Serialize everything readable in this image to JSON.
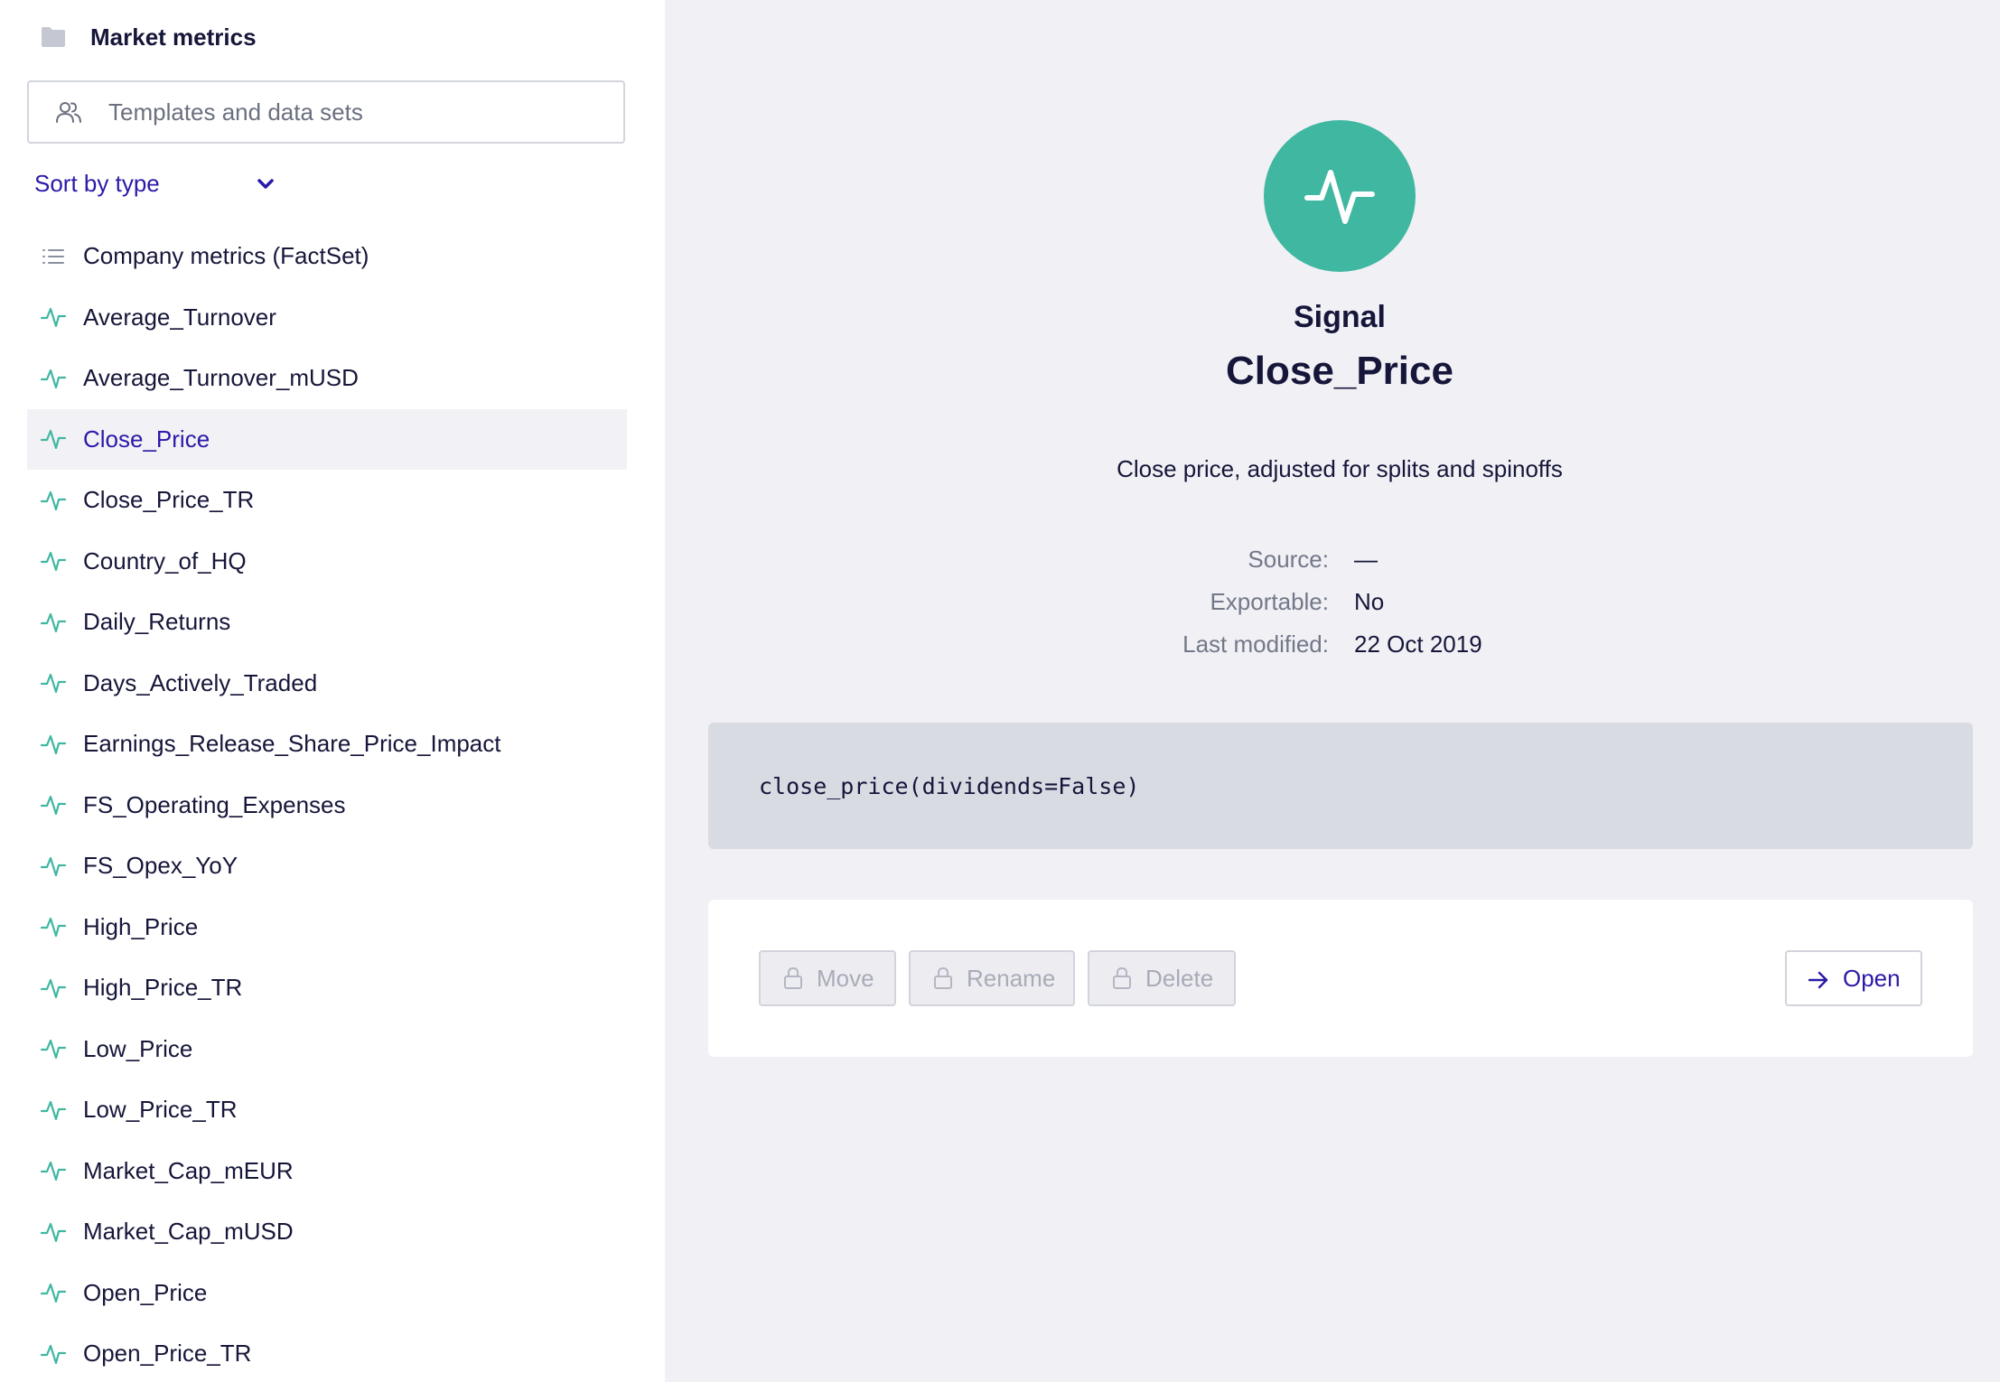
{
  "sidebar": {
    "title": "Market metrics",
    "folder_icon": "folder-icon",
    "search": {
      "placeholder": "Templates and data sets",
      "icon": "users-icon"
    },
    "sort": {
      "label": "Sort by type",
      "icon": "chevron-down-icon"
    },
    "items": [
      {
        "label": "Company metrics (FactSet)",
        "icon": "list-icon",
        "selected": false
      },
      {
        "label": "Average_Turnover",
        "icon": "signal-icon",
        "selected": false
      },
      {
        "label": "Average_Turnover_mUSD",
        "icon": "signal-icon",
        "selected": false
      },
      {
        "label": "Close_Price",
        "icon": "signal-icon",
        "selected": true
      },
      {
        "label": "Close_Price_TR",
        "icon": "signal-icon",
        "selected": false
      },
      {
        "label": "Country_of_HQ",
        "icon": "signal-icon",
        "selected": false
      },
      {
        "label": "Daily_Returns",
        "icon": "signal-icon",
        "selected": false
      },
      {
        "label": "Days_Actively_Traded",
        "icon": "signal-icon",
        "selected": false
      },
      {
        "label": "Earnings_Release_Share_Price_Impact",
        "icon": "signal-icon",
        "selected": false
      },
      {
        "label": "FS_Operating_Expenses",
        "icon": "signal-icon",
        "selected": false
      },
      {
        "label": "FS_Opex_YoY",
        "icon": "signal-icon",
        "selected": false
      },
      {
        "label": "High_Price",
        "icon": "signal-icon",
        "selected": false
      },
      {
        "label": "High_Price_TR",
        "icon": "signal-icon",
        "selected": false
      },
      {
        "label": "Low_Price",
        "icon": "signal-icon",
        "selected": false
      },
      {
        "label": "Low_Price_TR",
        "icon": "signal-icon",
        "selected": false
      },
      {
        "label": "Market_Cap_mEUR",
        "icon": "signal-icon",
        "selected": false
      },
      {
        "label": "Market_Cap_mUSD",
        "icon": "signal-icon",
        "selected": false
      },
      {
        "label": "Open_Price",
        "icon": "signal-icon",
        "selected": false
      },
      {
        "label": "Open_Price_TR",
        "icon": "signal-icon",
        "selected": false
      }
    ]
  },
  "detail": {
    "icon": "signal-icon",
    "kind": "Signal",
    "title": "Close_Price",
    "description": "Close price, adjusted for splits and spinoffs",
    "meta": [
      {
        "key": "Source:",
        "value": "—"
      },
      {
        "key": "Exportable:",
        "value": "No"
      },
      {
        "key": "Last modified:",
        "value": "22 Oct 2019"
      }
    ],
    "code": "close_price(dividends=False)",
    "actions": {
      "move_label": "Move",
      "rename_label": "Rename",
      "delete_label": "Delete",
      "open_label": "Open"
    }
  },
  "colors": {
    "accent": "#2a1aa8",
    "signal_green": "#40b7a0",
    "sidebar_bg": "#ffffff",
    "main_bg": "#f0f0f5",
    "selected_row_bg": "#f2f2f6",
    "code_bg": "#d9dbe3",
    "muted_text": "#737888"
  }
}
